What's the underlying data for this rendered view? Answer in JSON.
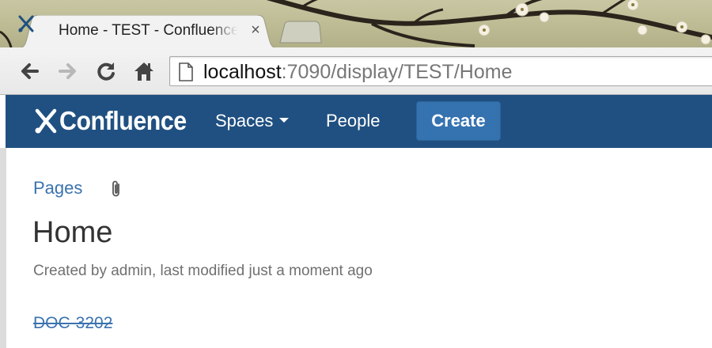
{
  "browser": {
    "tab_title": "Home - TEST - Confluence",
    "tab_close_glyph": "×",
    "url_host": "localhost",
    "url_rest": ":7090/display/TEST/Home",
    "icons": [
      "back-arrow-icon",
      "forward-arrow-icon",
      "reload-icon",
      "home-icon",
      "page-icon",
      "close-icon"
    ]
  },
  "header": {
    "brand": "Confluence",
    "nav": {
      "spaces": "Spaces",
      "people": "People"
    },
    "create_label": "Create",
    "colors": {
      "background": "#205081",
      "button": "#3572b0"
    }
  },
  "page": {
    "breadcrumb": "Pages",
    "title": "Home",
    "meta": "Created by admin, last modified just a moment ago",
    "issue_key": "DOC-3202",
    "link_color": "#3b73af"
  }
}
